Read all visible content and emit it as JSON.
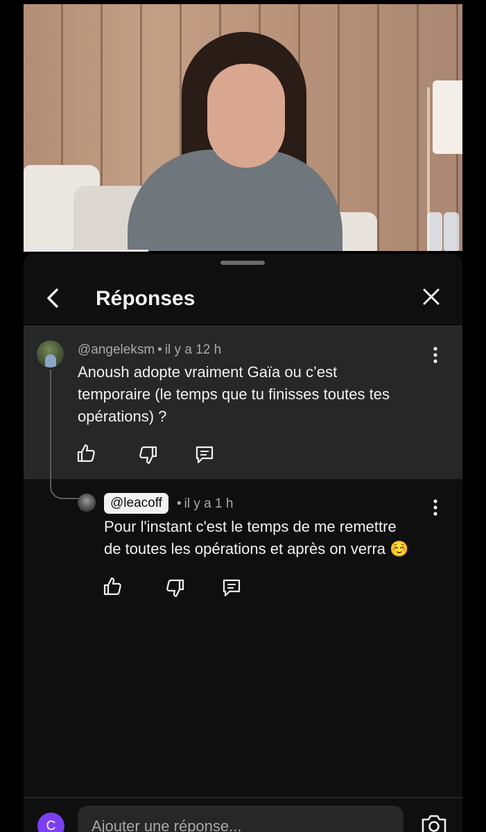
{
  "sheet": {
    "title": "Réponses"
  },
  "parent_comment": {
    "author": "@angeleksm",
    "time": "il y a 12 h",
    "text_lines": [
      "Anoush adopte vraiment Gaïa ou c’est",
      "temporaire (le temps que tu finisses toutes tes",
      "opérations) ?"
    ]
  },
  "reply": {
    "author": "@leacoff",
    "time": "il y a 1 h",
    "text_lines": [
      "Pour l'instant c'est le temps de me remettre",
      "de toutes les opérations et après on verra ☺️"
    ]
  },
  "composer": {
    "avatar_initial": "C",
    "placeholder": "Ajouter une réponse..."
  },
  "colors": {
    "background": "#0f0f0f",
    "highlight_comment_bg": "#272727",
    "text": "#f1f1f1",
    "meta_text": "#aaaaaa",
    "avatar_accent": "#7b3ff2"
  },
  "icons": {
    "back": "chevron-left-icon",
    "close": "close-icon",
    "more": "more-vertical-icon",
    "like": "thumb-up-icon",
    "dislike": "thumb-down-icon",
    "reply": "comment-icon",
    "camera": "camera-icon"
  }
}
